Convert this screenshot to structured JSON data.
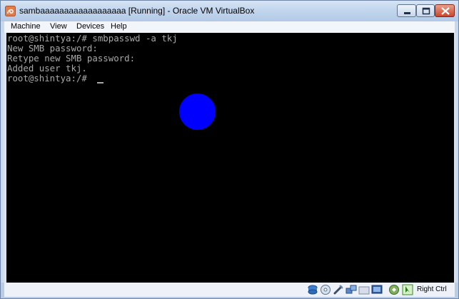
{
  "window": {
    "title": "sambaaaaaaaaaaaaaaaaaa [Running] - Oracle VM VirtualBox"
  },
  "menu": {
    "items": [
      "Machine",
      "View",
      "Devices",
      "Help"
    ]
  },
  "terminal": {
    "lines": [
      "root@shintya:/# smbpasswd -a tkj",
      "New SMB password:",
      "Retype new SMB password:",
      "Added user tkj.",
      "root@shintya:/# "
    ]
  },
  "statusbar": {
    "icons": [
      "hard-disk-icon",
      "optical-disk-icon",
      "usb-icon",
      "network-icon",
      "shared-folder-icon",
      "display-icon",
      "capture-icon",
      "mouse-integration-icon"
    ],
    "host_key_label": "Right Ctrl"
  },
  "colors": {
    "terminal_bg": "#000000",
    "terminal_fg": "#a8a8a8",
    "blob": "#0000ff"
  }
}
